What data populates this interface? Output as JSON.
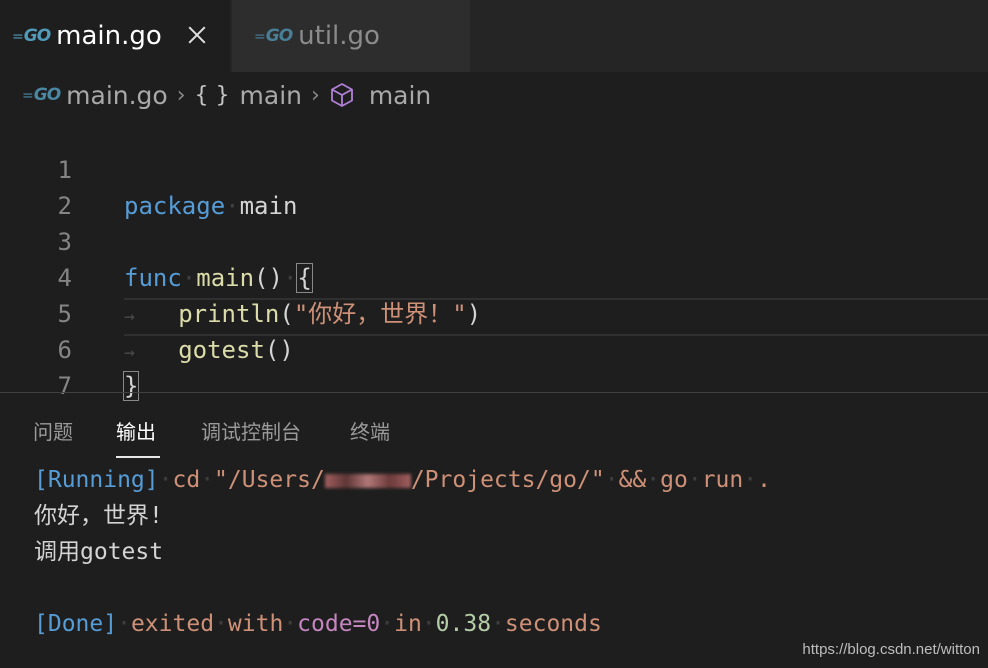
{
  "tabs": [
    {
      "label": "main.go",
      "icon": "go-file-icon",
      "active": true
    },
    {
      "label": "util.go",
      "icon": "go-file-icon",
      "active": false
    }
  ],
  "breadcrumb": {
    "file": "main.go",
    "scope": "main",
    "symbol": "main"
  },
  "editor": {
    "line_numbers": [
      "1",
      "2",
      "3",
      "4",
      "5",
      "6",
      "7"
    ],
    "lines": {
      "l1_kw": "package",
      "l1_id": "main",
      "l3_kw": "func",
      "l3_fn": "main",
      "l3_paren": "()",
      "l3_brace": "{",
      "l4_fn": "println",
      "l4_open": "(",
      "l4_str": "\"你好，世界！\"",
      "l4_close": ")",
      "l5_fn": "gotest",
      "l5_paren": "()",
      "l6_brace": "}"
    }
  },
  "panel": {
    "tabs": [
      "问题",
      "输出",
      "调试控制台",
      "终端"
    ],
    "active_tab": "输出"
  },
  "output": {
    "running_tag": "[Running]",
    "cmd_cd": "cd",
    "path_start": "\"/Users/",
    "path_end": "/Projects/go/\"",
    "cmd_rest_amp": "&&",
    "cmd_go": "go",
    "cmd_run": "run",
    "cmd_dot": ".",
    "line2": "你好，世界!",
    "line3": "调用gotest",
    "done_tag": "[Done]",
    "exited": "exited",
    "with": "with",
    "code": "code=0",
    "in": "in",
    "time": "0.38",
    "seconds": "seconds"
  },
  "watermark": "https://blog.csdn.net/witton",
  "colors": {
    "keyword": "#569cd6",
    "function": "#dcdcaa",
    "string": "#ce9178",
    "number": "#b5cea8",
    "purple": "#c586c0"
  }
}
